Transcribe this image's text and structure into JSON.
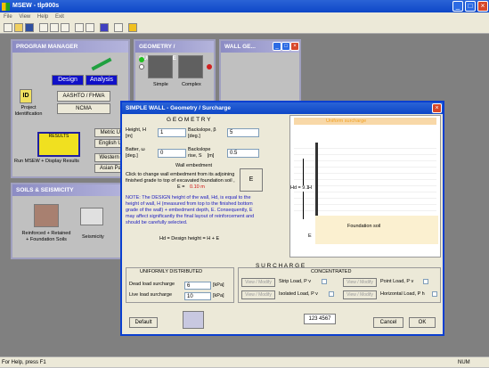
{
  "app": {
    "title": "MSEW - tlp900s",
    "menu": [
      "File",
      "View",
      "Help",
      "Exit"
    ],
    "status_left": "For Help, press F1",
    "status_right": "NUM"
  },
  "program_manager": {
    "title": "PROGRAM MANAGER",
    "design_label": "Design",
    "analysis_label": "Analysis",
    "project_label": "Project Identification",
    "id_label": "ID",
    "aashto": "AASHTO / FHWA",
    "ncma": "NCMA",
    "metric": "Metric Unit",
    "english": "English Unit",
    "western": "Western Ve",
    "asian": "Asian Pacif",
    "results_label": "RESULTS",
    "run_label": "Run MSEW + Display Results"
  },
  "soils": {
    "title": "SOILS & SEISMICITY",
    "reinforced": "Reinforced + Retained + Foundation Soils",
    "seismicity": "Seismicity"
  },
  "geometry_panel": {
    "title": "GEOMETRY / SURCHARGE",
    "simple": "Simple",
    "complex": "Complex"
  },
  "wall_panel": {
    "title": "WALL GE..."
  },
  "dialog": {
    "title": "SIMPLE WALL - Geometry / Surcharge",
    "geometry_heading": "G E O M E T R Y",
    "height_label": "Height, H\n[m]",
    "height_value": "1",
    "backslope_label": "Backslope, β\n[deg.]",
    "backslope_value": "5",
    "batter_label": "Batter, ω\n[deg.]",
    "batter_value": "0",
    "backslope_rise_label": "Backslope\nrise, S    [m]",
    "backslope_rise_value": "0.5",
    "embedment_heading": "Wall embedment",
    "embedment_text": "Click to change wall embedment from its adjoining finished grade to top of excavated foundation soil ,",
    "embedment_e": "E = ",
    "embedment_value": "0.10 m",
    "e_button": "E",
    "note_text": "NOTE: The DESIGN height of the wall, Hd, is equal to the height of wall, H (measured from top to the finished bottom grade of the wall) + embedment depth, E. Consequently, E may affect significantly the final layout of reinforcement and should be carefully selected.",
    "hd_formula": "Hd = Design height = H + E",
    "uniform_surcharge": "Uniform surcharge",
    "hd_label": "Hd = 9.1",
    "h_label": "H",
    "e_label": "E",
    "foundation_soil": "Foundation  soil",
    "surcharge_heading": "S U R C H A R G E",
    "uniform_heading": "UNIFORMLY  DISTRIBUTED",
    "dead_label": "Dead load surcharge",
    "dead_value": "6",
    "dead_unit": "[kPa]",
    "live_label": "Live load surcharge",
    "live_value": "10",
    "live_unit": "[kPa]",
    "concentrated_heading": "CONCENTRATED",
    "view_modify": "View / Modify",
    "strip_load": "Strip Load,  P v",
    "isolated_load": "Isolated Load,  P v",
    "point_load": "Point Load,   P v",
    "horizontal_load": "Horizontal Load,  P h",
    "default_button": "Default",
    "counter": "123 4567",
    "cancel_button": "Cancel",
    "ok_button": "OK"
  }
}
